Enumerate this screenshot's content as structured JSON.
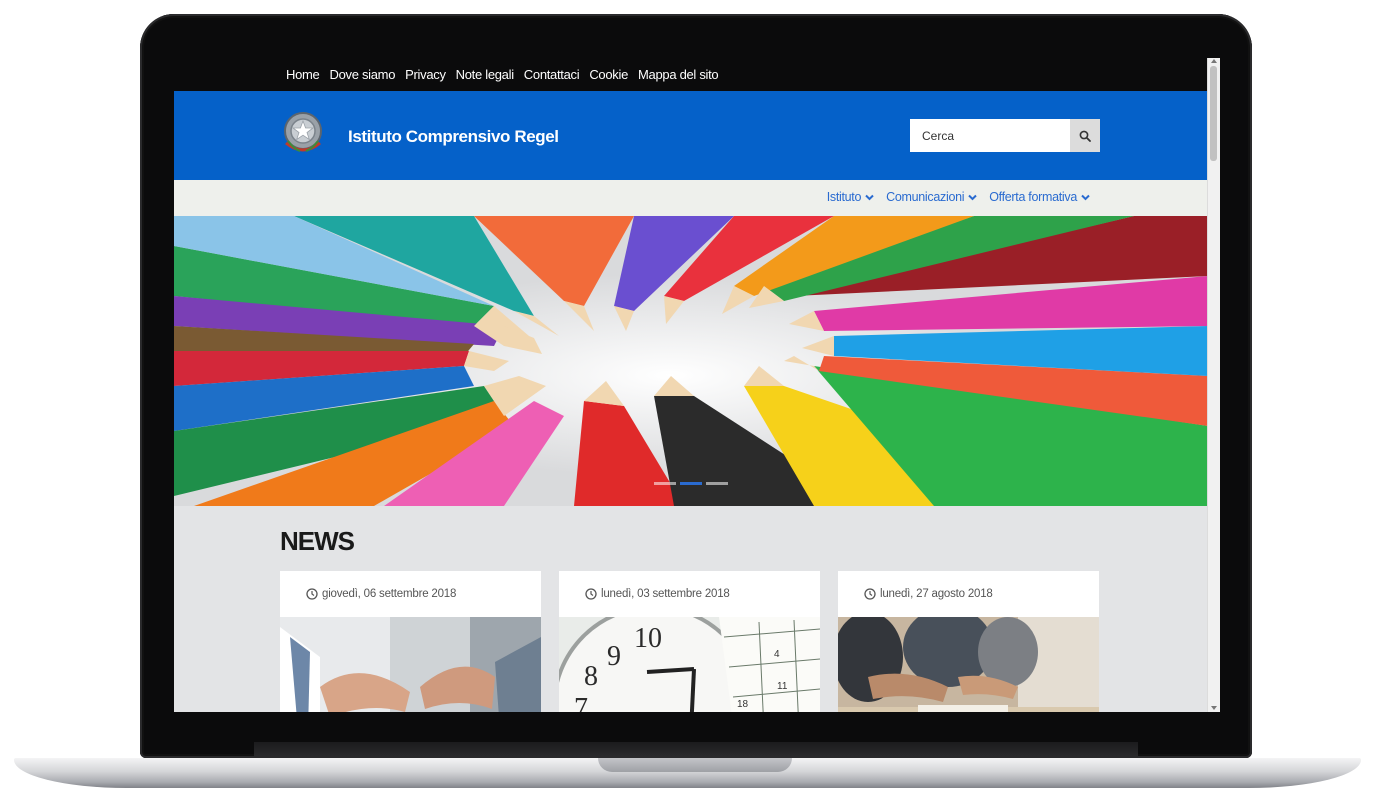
{
  "top_links": [
    "Home",
    "Dove siamo",
    "Privacy",
    "Note legali",
    "Contattaci",
    "Cookie",
    "Mappa del sito"
  ],
  "header": {
    "site_title": "Istituto Comprensivo Regel",
    "search_placeholder": "Cerca"
  },
  "main_nav": [
    {
      "label": "Istituto"
    },
    {
      "label": "Comunicazioni"
    },
    {
      "label": "Offerta formativa"
    }
  ],
  "news": {
    "title": "NEWS",
    "cards": [
      {
        "date": "giovedì, 06 settembre 2018",
        "image": "handshake-photo"
      },
      {
        "date": "lunedì, 03 settembre 2018",
        "image": "clock-calendar-photo"
      },
      {
        "date": "lunedì, 27 agosto 2018",
        "image": "students-photo"
      }
    ]
  },
  "hero": {
    "image": "colored-pencils-photo",
    "slides": 3,
    "active_slide": 1
  },
  "colors": {
    "header_blue": "#0561c9",
    "link_blue": "#2a6bd0",
    "nav_bg": "#eef0ec",
    "top_bar": "#0b0b0c"
  },
  "icons": [
    "search-icon",
    "chevron-down-icon",
    "clock-icon",
    "emblem-logo"
  ]
}
